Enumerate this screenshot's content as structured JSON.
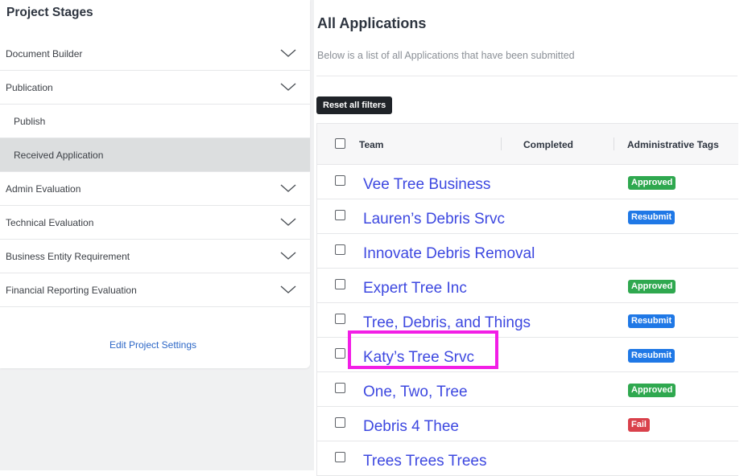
{
  "sidebar": {
    "title": "Project Stages",
    "stages": [
      {
        "label": "Document Builder",
        "expandable": true
      },
      {
        "label": "Publication",
        "expandable": true,
        "expanded": true
      },
      {
        "label": "Publish",
        "sub": true
      },
      {
        "label": "Received Application",
        "sub": true,
        "selected": true
      },
      {
        "label": "Admin Evaluation",
        "expandable": true
      },
      {
        "label": "Technical Evaluation",
        "expandable": true
      },
      {
        "label": "Business Entity Requirement",
        "expandable": true
      },
      {
        "label": "Financial Reporting Evaluation",
        "expandable": true
      }
    ],
    "settings_link": "Edit Project Settings"
  },
  "main": {
    "title": "All Applications",
    "subtitle": "Below is a list of all Applications that have been submitted",
    "reset_label": "Reset all filters",
    "table": {
      "columns": [
        "Team",
        "Completed",
        "Administrative Tags"
      ],
      "rows": [
        {
          "team": "Vee Tree Business",
          "tag": "Approved",
          "tag_color": "green"
        },
        {
          "team": "Lauren’s Debris Srvc",
          "tag": "Resubmit",
          "tag_color": "blue"
        },
        {
          "team": "Innovate Debris Removal",
          "tag": "",
          "tag_color": ""
        },
        {
          "team": "Expert Tree Inc",
          "tag": "Approved",
          "tag_color": "green"
        },
        {
          "team": "Tree, Debris, and Things",
          "tag": "Resubmit",
          "tag_color": "blue"
        },
        {
          "team": "Katy’s Tree Srvc",
          "tag": "Resubmit",
          "tag_color": "blue",
          "highlighted": true
        },
        {
          "team": "One, Two, Tree",
          "tag": "Approved",
          "tag_color": "green"
        },
        {
          "team": "Debris 4 Thee",
          "tag": "Fail",
          "tag_color": "red"
        },
        {
          "team": "Trees Trees Trees",
          "tag": "",
          "tag_color": ""
        }
      ]
    }
  },
  "colors": {
    "link": "#3d48e0",
    "approved": "#2fa84f",
    "resubmit": "#1f78e6",
    "fail": "#d9414b",
    "highlight": "#f21ee6"
  },
  "icons": {
    "chevron": "chevron-down-icon",
    "checkbox": "checkbox-icon"
  }
}
